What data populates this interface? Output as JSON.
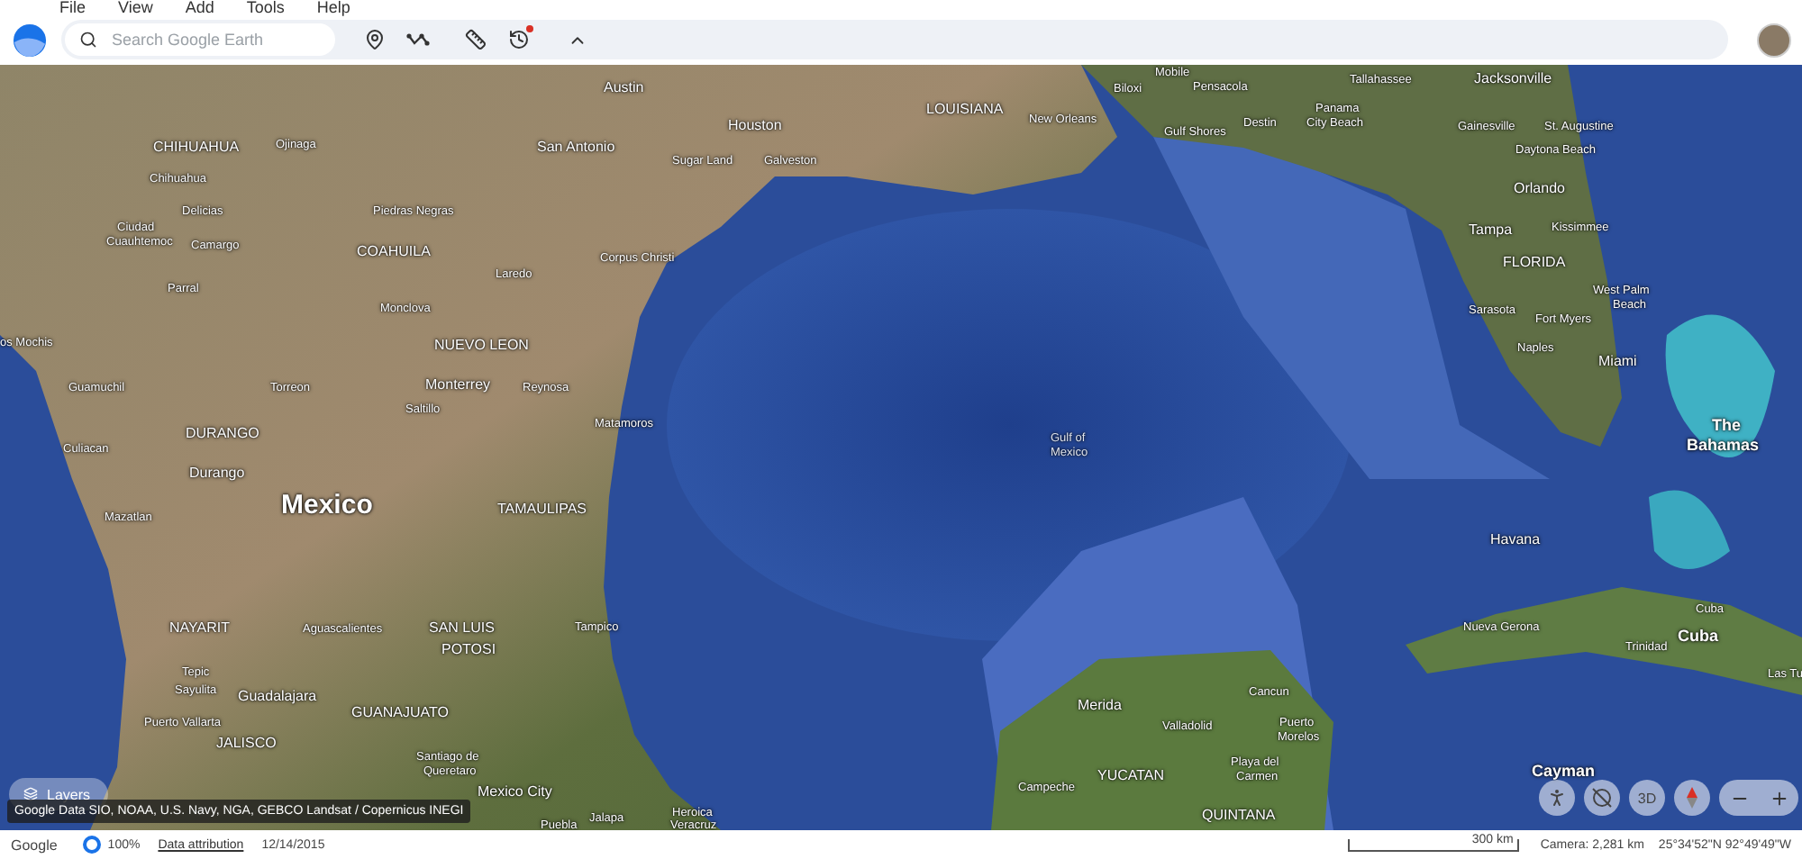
{
  "menu": [
    "File",
    "View",
    "Add",
    "Tools",
    "Help"
  ],
  "search": {
    "placeholder": "Search Google Earth"
  },
  "map": {
    "labels": [
      {
        "text": "Austin",
        "kind": "city"
      },
      {
        "text": "Houston",
        "kind": "city"
      },
      {
        "text": "San Antonio",
        "kind": "city"
      },
      {
        "text": "Sugar Land",
        "kind": "town"
      },
      {
        "text": "Galveston",
        "kind": "town"
      },
      {
        "text": "CHIHUAHUA",
        "kind": "region"
      },
      {
        "text": "Ojinaga",
        "kind": "town"
      },
      {
        "text": "Chihuahua",
        "kind": "town"
      },
      {
        "text": "Delicias",
        "kind": "town"
      },
      {
        "text": "Ciudad",
        "kind": "town"
      },
      {
        "text": "Cuauhtemoc",
        "kind": "town"
      },
      {
        "text": "Camargo",
        "kind": "town"
      },
      {
        "text": "Piedras Negras",
        "kind": "town"
      },
      {
        "text": "COAHUILA",
        "kind": "region"
      },
      {
        "text": "Parral",
        "kind": "town"
      },
      {
        "text": "Corpus Christi",
        "kind": "town"
      },
      {
        "text": "Laredo",
        "kind": "town"
      },
      {
        "text": "Monclova",
        "kind": "town"
      },
      {
        "text": "os Mochis",
        "kind": "town"
      },
      {
        "text": "NUEVO LEON",
        "kind": "region"
      },
      {
        "text": "Guamuchil",
        "kind": "town"
      },
      {
        "text": "Torreon",
        "kind": "town"
      },
      {
        "text": "Monterrey",
        "kind": "city"
      },
      {
        "text": "Reynosa",
        "kind": "town"
      },
      {
        "text": "Saltillo",
        "kind": "town"
      },
      {
        "text": "Matamoros",
        "kind": "town"
      },
      {
        "text": "Culiacan",
        "kind": "town"
      },
      {
        "text": "DURANGO",
        "kind": "region"
      },
      {
        "text": "Durango",
        "kind": "city"
      },
      {
        "text": "Mexico",
        "kind": "country"
      },
      {
        "text": "TAMAULIPAS",
        "kind": "region"
      },
      {
        "text": "Mazatlan",
        "kind": "town"
      },
      {
        "text": "NAYARIT",
        "kind": "region"
      },
      {
        "text": "Aguascalientes",
        "kind": "town"
      },
      {
        "text": "SAN LUIS",
        "kind": "region"
      },
      {
        "text": "POTOSI",
        "kind": "region"
      },
      {
        "text": "Tampico",
        "kind": "town"
      },
      {
        "text": "Tepic",
        "kind": "town"
      },
      {
        "text": "Sayulita",
        "kind": "town"
      },
      {
        "text": "Guadalajara",
        "kind": "city"
      },
      {
        "text": "Puerto Vallarta",
        "kind": "town"
      },
      {
        "text": "GUANAJUATO",
        "kind": "region"
      },
      {
        "text": "JALISCO",
        "kind": "region"
      },
      {
        "text": "Santiago de",
        "kind": "town"
      },
      {
        "text": "Queretaro",
        "kind": "town"
      },
      {
        "text": "Mexico City",
        "kind": "city"
      },
      {
        "text": "Jalapa",
        "kind": "town"
      },
      {
        "text": "Puebla",
        "kind": "town"
      },
      {
        "text": "Heroica",
        "kind": "town"
      },
      {
        "text": "Veracruz",
        "kind": "town"
      },
      {
        "text": "Mobile",
        "kind": "town"
      },
      {
        "text": "Biloxi",
        "kind": "town"
      },
      {
        "text": "Pensacola",
        "kind": "town"
      },
      {
        "text": "Tallahassee",
        "kind": "town"
      },
      {
        "text": "Jacksonville",
        "kind": "city"
      },
      {
        "text": "LOUISIANA",
        "kind": "region"
      },
      {
        "text": "New Orleans",
        "kind": "town"
      },
      {
        "text": "Gulf Shores",
        "kind": "town"
      },
      {
        "text": "Destin",
        "kind": "town"
      },
      {
        "text": "Panama",
        "kind": "town"
      },
      {
        "text": "City Beach",
        "kind": "town"
      },
      {
        "text": "Gainesville",
        "kind": "town"
      },
      {
        "text": "St. Augustine",
        "kind": "town"
      },
      {
        "text": "Daytona Beach",
        "kind": "town"
      },
      {
        "text": "Orlando",
        "kind": "city"
      },
      {
        "text": "Tampa",
        "kind": "city"
      },
      {
        "text": "Kissimmee",
        "kind": "town"
      },
      {
        "text": "FLORIDA",
        "kind": "region"
      },
      {
        "text": "West Palm",
        "kind": "town"
      },
      {
        "text": "Beach",
        "kind": "town"
      },
      {
        "text": "Sarasota",
        "kind": "town"
      },
      {
        "text": "Fort Myers",
        "kind": "town"
      },
      {
        "text": "Naples",
        "kind": "town"
      },
      {
        "text": "Miami",
        "kind": "city"
      },
      {
        "text": "The",
        "kind": "island"
      },
      {
        "text": "Bahamas",
        "kind": "island"
      },
      {
        "text": "Gulf of",
        "kind": "water"
      },
      {
        "text": "Mexico",
        "kind": "water"
      },
      {
        "text": "Havana",
        "kind": "city"
      },
      {
        "text": "Nueva Gerona",
        "kind": "town"
      },
      {
        "text": "Cuba",
        "kind": "town"
      },
      {
        "text": "Cuba",
        "kind": "island"
      },
      {
        "text": "Trinidad",
        "kind": "town"
      },
      {
        "text": "Las Tu",
        "kind": "town"
      },
      {
        "text": "Merida",
        "kind": "city"
      },
      {
        "text": "Valladolid",
        "kind": "town"
      },
      {
        "text": "Cancun",
        "kind": "town"
      },
      {
        "text": "Puerto",
        "kind": "town"
      },
      {
        "text": "Morelos",
        "kind": "town"
      },
      {
        "text": "Playa del",
        "kind": "town"
      },
      {
        "text": "YUCATAN",
        "kind": "region"
      },
      {
        "text": "Carmen",
        "kind": "town"
      },
      {
        "text": "Campeche",
        "kind": "town"
      },
      {
        "text": "QUINTANA",
        "kind": "region"
      },
      {
        "text": "Cayman",
        "kind": "island"
      }
    ]
  },
  "layers_button": "Layers",
  "attribution": "Google Data SIO, NOAA, U.S. Navy, NGA, GEBCO Landsat / Copernicus INEGI",
  "map_controls": {
    "mode_3d": "3D"
  },
  "status_bar": {
    "brand": "Google",
    "zoom": "100%",
    "link": "Data attribution",
    "date": "12/14/2015",
    "scale": "300 km",
    "camera": "Camera: 2,281 km",
    "coordinates": "25°34'52\"N 92°49'49\"W"
  }
}
